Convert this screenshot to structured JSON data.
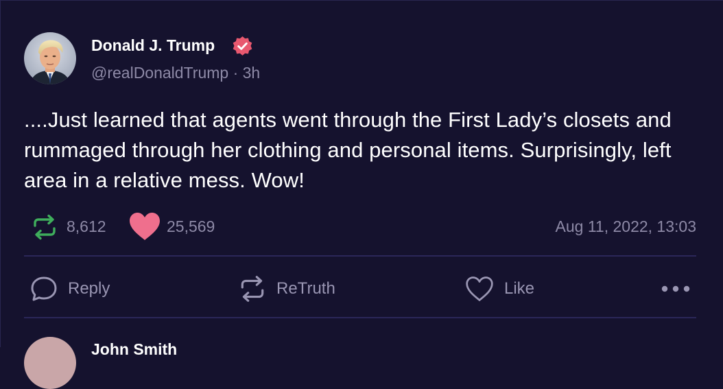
{
  "post": {
    "author": {
      "name": "Donald J. Trump",
      "handle": "@realDonaldTrump",
      "separator": "·",
      "time_ago": "3h",
      "verified_color": "#e8586f"
    },
    "text": "....Just learned that agents went through the First Lady’s closets and rummaged through her clothing and personal items. Surprisingly, left area in a relative mess. Wow!",
    "stats": {
      "retruths": "8,612",
      "likes": "25,569",
      "timestamp": "Aug 11, 2022, 13:03",
      "retruth_icon_color": "#3fae5c",
      "like_icon_color": "#ef6f8d"
    },
    "actions": {
      "reply_label": "Reply",
      "retruth_label": "ReTruth",
      "like_label": "Like",
      "more_icon": "more-horizontal-icon"
    }
  },
  "next_post": {
    "author_name": "John Smith"
  },
  "theme": {
    "background": "#15122e",
    "divider": "#2b2759",
    "muted_text": "#8e8aa7"
  }
}
